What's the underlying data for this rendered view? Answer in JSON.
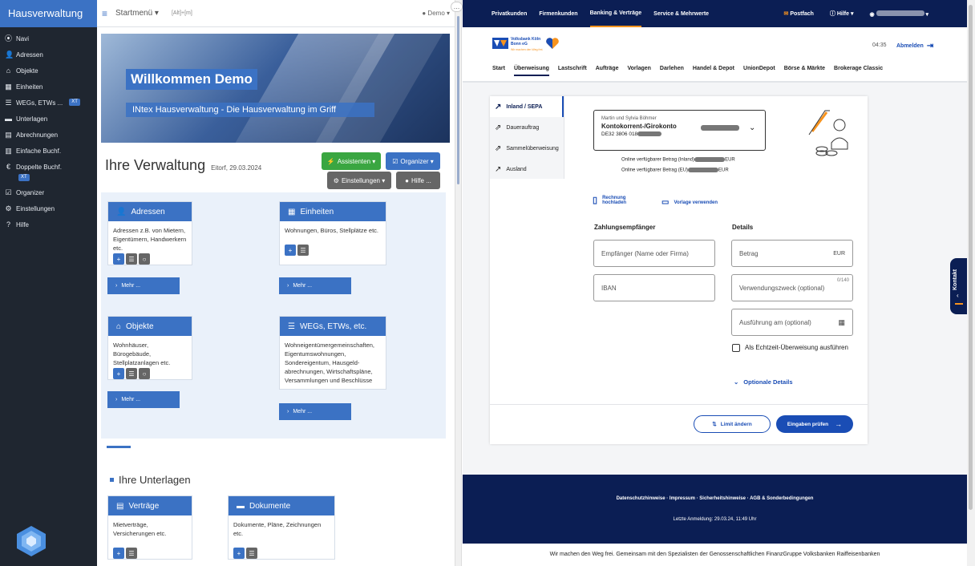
{
  "left": {
    "brand": "Hausverwaltung",
    "nav": [
      {
        "icon": "circle-dot-icon",
        "glyph": "⦿",
        "label": "Navi"
      },
      {
        "icon": "user-icon",
        "glyph": "👤",
        "label": "Adressen"
      },
      {
        "icon": "home-icon",
        "glyph": "⌂",
        "label": "Objekte"
      },
      {
        "icon": "grid-icon",
        "glyph": "▦",
        "label": "Einheiten"
      },
      {
        "icon": "list-icon",
        "glyph": "☰",
        "label": "WEGs, ETWs ...",
        "badge": "XT"
      },
      {
        "icon": "folder-icon",
        "glyph": "▬",
        "label": "Unterlagen"
      },
      {
        "icon": "file-icon",
        "glyph": "▤",
        "label": "Abrechnungen"
      },
      {
        "icon": "book-icon",
        "glyph": "▥",
        "label": "Einfache Buchf."
      },
      {
        "icon": "euro-icon",
        "glyph": "€",
        "label": "Doppelte Buchf.",
        "badge": "XT"
      },
      {
        "icon": "check-square-icon",
        "glyph": "☑",
        "label": "Organizer"
      },
      {
        "icon": "gear-icon",
        "glyph": "⚙",
        "label": "Einstellungen"
      },
      {
        "icon": "help-circle-icon",
        "glyph": "?",
        "label": "Hilfe"
      }
    ],
    "topbar": {
      "menu": "Startmenü ▾",
      "shortcut": "[Alt]+[m]",
      "user": "Demo ▾"
    },
    "hero": {
      "title": "Willkommen Demo",
      "subtitle": "INtex Hausverwaltung - Die Hausverwaltung im Griff"
    },
    "heading": "Ihre Verwaltung",
    "date": "Eitorf, 29.03.2024",
    "buttons": {
      "assistenten": "Assistenten ▾",
      "organizer": "Organizer ▾",
      "einstellungen": "Einstellungen ▾",
      "hilfe": "Hilfe ..."
    },
    "cards": [
      {
        "title": "Adressen",
        "text": "Adressen z.B. von Mietern, Eigentümern, Handwerkern etc."
      },
      {
        "title": "Einheiten",
        "text": "Wohnungen, Büros, Stellplätze etc."
      },
      {
        "title": "Objekte",
        "text": "Wohnhäuser, Bürogebäude, Stellplatzanlagen etc."
      },
      {
        "title": "WEGs, ETWs, etc.",
        "text": "Wohneigentümergemeinschaften, Eigentumswohnungen, Sondereigentum, Hausgeld-abrechnungen, Wirtschaftspläne, Versammlungen und Beschlüsse"
      }
    ],
    "more": "Mehr ...",
    "unterlagen": "Ihre Unterlagen",
    "docs": [
      {
        "title": "Verträge",
        "text": "Mietverträge, Versicherungen etc."
      },
      {
        "title": "Dokumente",
        "text": "Dokumente, Pläne, Zeichnungen etc."
      }
    ]
  },
  "bank": {
    "topnav": [
      "Privatkunden",
      "Firmenkunden",
      "Banking & Verträge",
      "Service & Mehrwerte"
    ],
    "active_topnav": "Banking & Verträge",
    "postfach": "Postfach",
    "hilfe": "Hilfe",
    "bank_name": "Volksbank Köln Bonn eG",
    "bank_tagline": "Wir machen den Weg frei.",
    "time": "04:35",
    "logout": "Abmelden",
    "tabs": [
      "Start",
      "Überweisung",
      "Lastschrift",
      "Aufträge",
      "Vorlagen",
      "Darlehen",
      "Handel & Depot",
      "UnionDepot",
      "Börse & Märkte",
      "Brokerage Classic"
    ],
    "side": [
      "Inland / SEPA",
      "Dauerauftrag",
      "Sammelüberweisung",
      "Ausland"
    ],
    "account": {
      "holder": "Martin und Sylvia Böhmer",
      "name": "Kontokorrent-/Girokonto",
      "iban_prefix": "DE32 3806 018"
    },
    "avail_inland": "Online verfügbarer Betrag (Inland)",
    "avail_eu": "Online verfügbarer Betrag (EU)",
    "currency": "EUR",
    "upload": "Rechnung hochladen",
    "template": "Vorlage verwenden",
    "payee_heading": "Zahlungsempfänger",
    "details_heading": "Details",
    "payee_ph": "Empfänger (Name oder Firma)",
    "iban_ph": "IBAN",
    "amount_ph": "Betrag",
    "purpose_ph": "Verwendungszweck (optional)",
    "purpose_count": "0/140",
    "date_ph": "Ausführung am (optional)",
    "realtime": "Als Echtzeit-Überweisung ausführen",
    "optional": "Optionale Details",
    "limit": "Limit ändern",
    "check": "Eingaben prüfen",
    "footer_links": "Datenschutzhinweise · Impressum · Sicherheitshinweise · AGB & Sonderbedingungen",
    "last_login": "Letzte Anmeldung: 29.03.24, 11:49 Uhr",
    "slogan": "Wir machen den Weg frei. Gemeinsam mit den Spezialisten der Genossenschaftlichen FinanzGruppe Volksbanken Raiffeisenbanken",
    "kontakt": "Kontakt"
  },
  "colors": {
    "accent": "#3b72c4",
    "bank_navy": "#0b1e54",
    "bank_blue": "#1a4db5",
    "green": "#3aa641",
    "orange": "#f7931e"
  }
}
